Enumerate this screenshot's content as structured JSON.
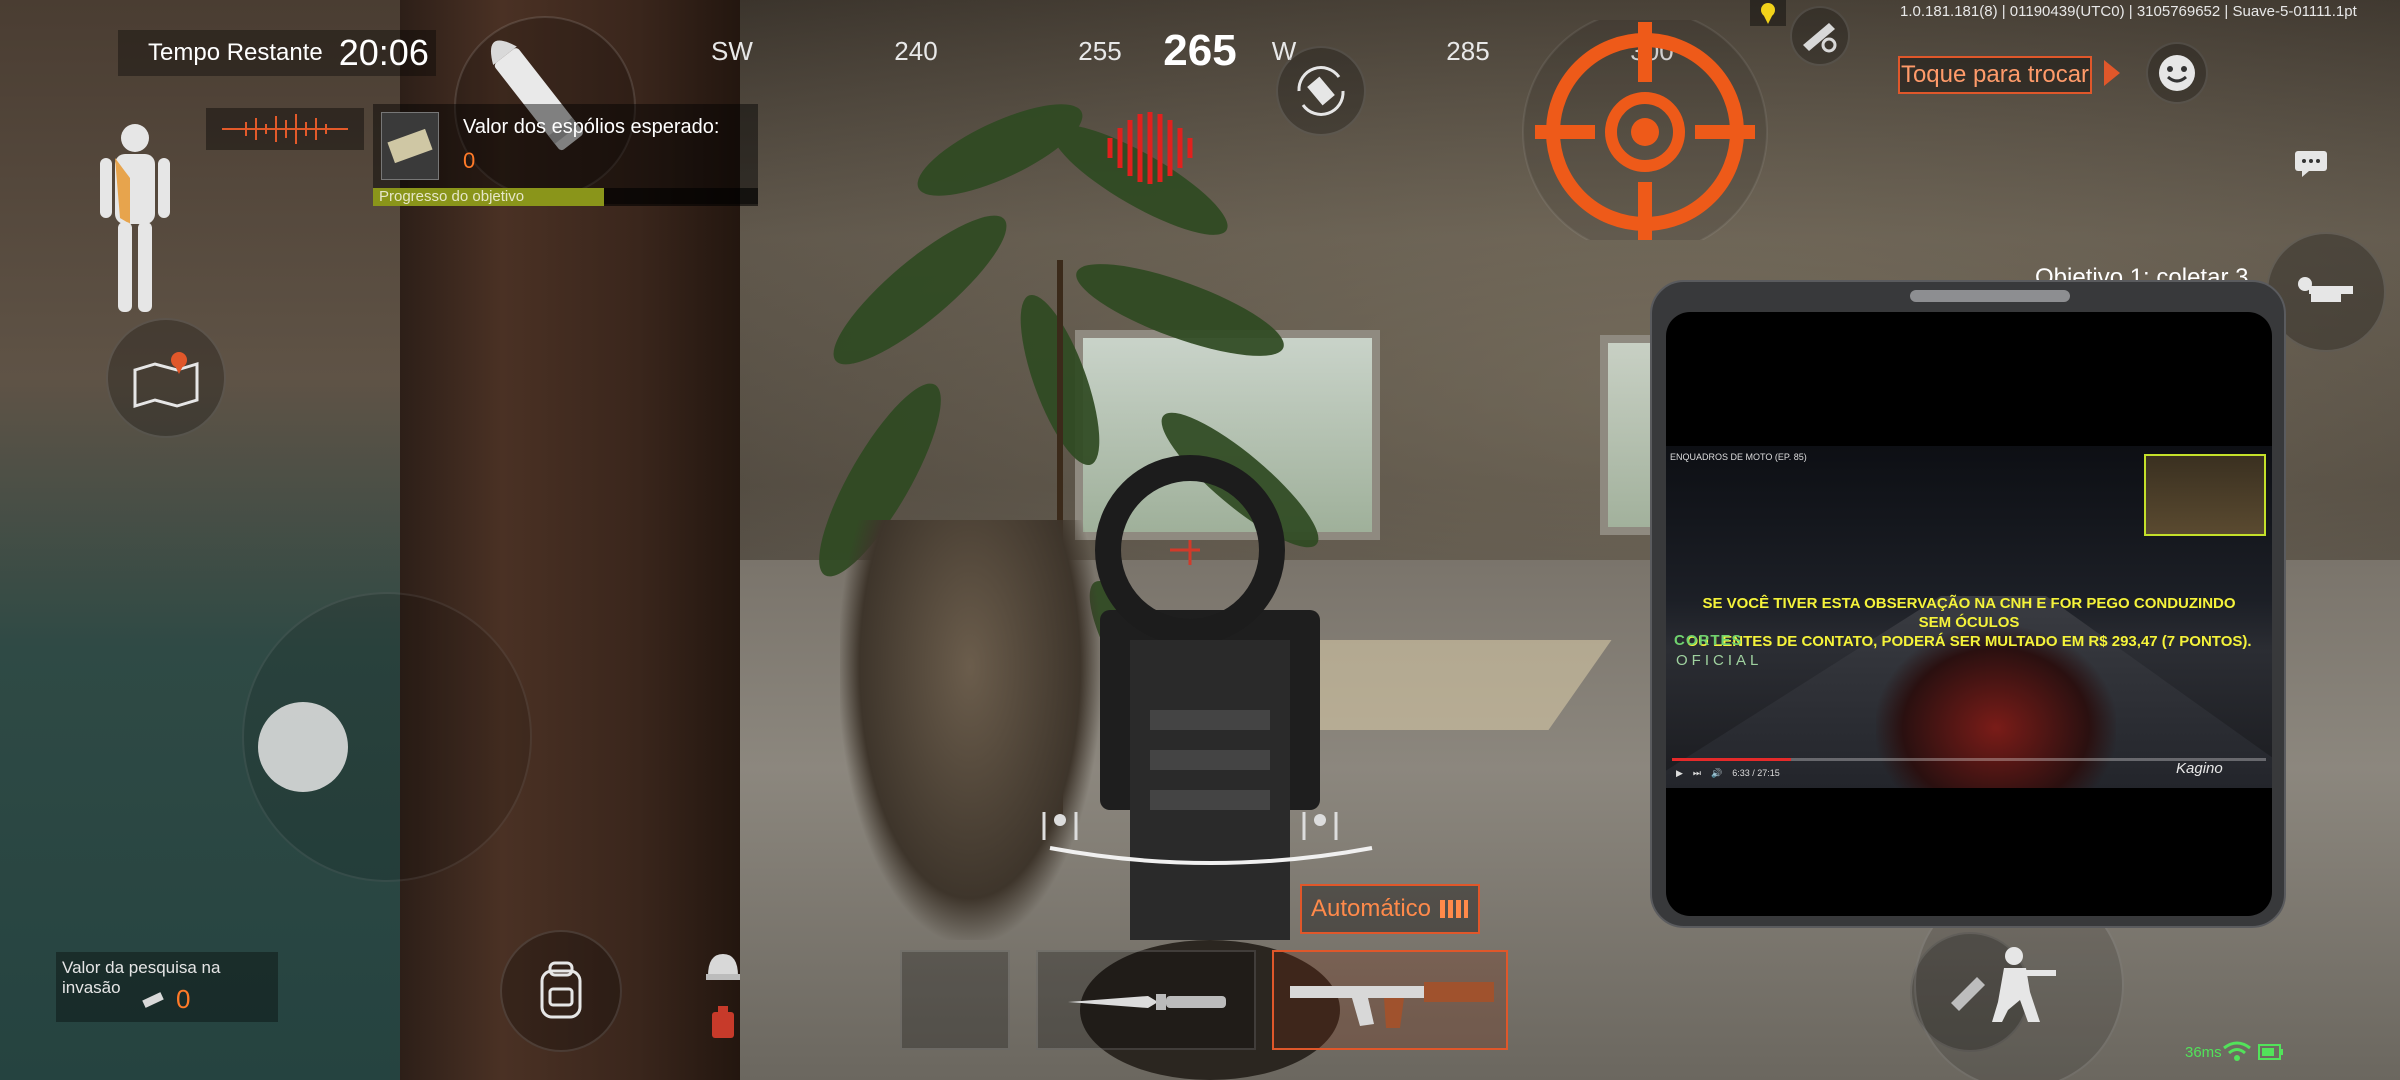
{
  "hud": {
    "timer_label": "Tempo Restante",
    "timer_value": "20:06",
    "compass": [
      "SW",
      "240",
      "255",
      "265",
      "W",
      "285",
      "300"
    ],
    "compass_current": "265",
    "objective_panel": {
      "title": "Valor dos espólios esperado:",
      "value": "0",
      "progress_label": "Progresso do objetivo",
      "progress_fraction": 0.6
    },
    "invasion": {
      "label": "Valor da pesquisa na invasão",
      "value": "0"
    },
    "change_button": "Toque para trocar",
    "version": "1.0.181.181(8) | 01190439(UTC0) | 3105769652 | Suave-5-01111.1pt",
    "ping": "36ms",
    "fire_mode": "Automático",
    "objective_text": "Objetivo 1: coletar 3"
  },
  "video_overlay": {
    "title": "ENQUADROS DE MOTO (EP. 85)",
    "subtitle_line1": "SE VOCÊ TIVER ESTA OBSERVAÇÃO NA CNH E FOR PEGO CONDUZINDO SEM ÓCULOS",
    "subtitle_line2": "OU LENTES DE CONTATO, PODERÁ SER MULTADO EM R$ 293,47 (7 PONTOS).",
    "brand": "CORTES",
    "brand_sub": "OFICIAL",
    "time": "6:33 / 27:15",
    "logo": "Kagino",
    "progress_fraction": 0.2
  },
  "icons": {
    "colors": {
      "accent": "#e0572a",
      "crosshair": "#ee5a19",
      "progress": "#8a951a",
      "subtitle": "#f5f33a",
      "ping": "#52e25a"
    }
  }
}
